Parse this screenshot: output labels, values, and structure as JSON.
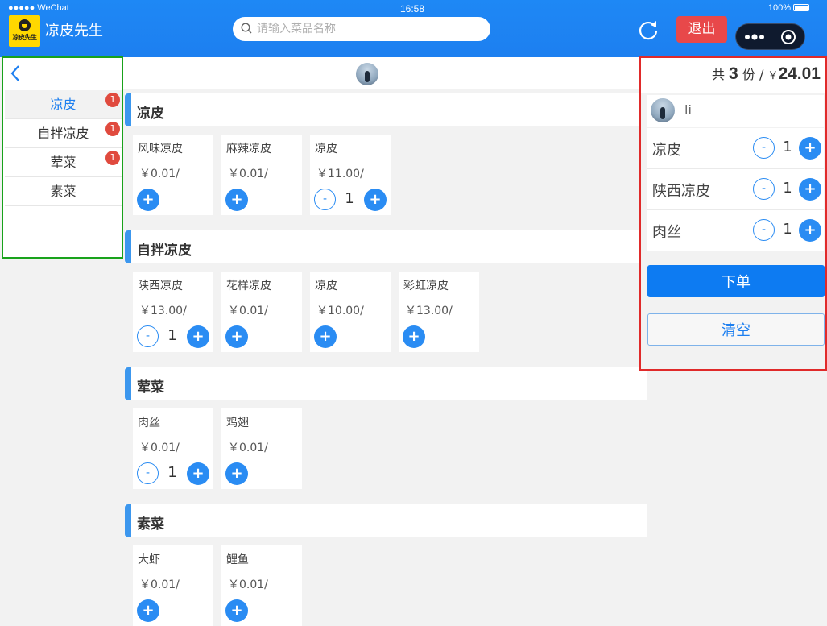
{
  "status_bar": {
    "carrier": "●●●●● WeChat",
    "time": "16:58",
    "battery": "100%"
  },
  "header": {
    "logo_text": "凉皮先生",
    "title": "凉皮先生",
    "search_placeholder": "请输入菜品名称",
    "logout_label": "退出"
  },
  "categories": [
    {
      "label": "凉皮",
      "badge": "1"
    },
    {
      "label": "自拌凉皮",
      "badge": "1"
    },
    {
      "label": "荤菜",
      "badge": "1"
    },
    {
      "label": "素菜",
      "badge": ""
    }
  ],
  "sections": [
    {
      "title": "凉皮",
      "items": [
        {
          "name": "风味凉皮",
          "price": "￥0.01/",
          "qty": ""
        },
        {
          "name": "麻辣凉皮",
          "price": "￥0.01/",
          "qty": ""
        },
        {
          "name": "凉皮",
          "price": "￥11.00/",
          "qty": "1"
        }
      ]
    },
    {
      "title": "自拌凉皮",
      "items": [
        {
          "name": "陕西凉皮",
          "price": "￥13.00/",
          "qty": "1"
        },
        {
          "name": "花样凉皮",
          "price": "￥0.01/",
          "qty": ""
        },
        {
          "name": "凉皮",
          "price": "￥10.00/",
          "qty": ""
        },
        {
          "name": "彩虹凉皮",
          "price": "￥13.00/",
          "qty": ""
        }
      ]
    },
    {
      "title": "荤菜",
      "items": [
        {
          "name": "肉丝",
          "price": "￥0.01/",
          "qty": "1"
        },
        {
          "name": "鸡翅",
          "price": "￥0.01/",
          "qty": ""
        }
      ]
    },
    {
      "title": "素菜",
      "items": [
        {
          "name": "大虾",
          "price": "￥0.01/",
          "qty": ""
        },
        {
          "name": "鲤鱼",
          "price": "￥0.01/",
          "qty": ""
        }
      ]
    }
  ],
  "symbols": {
    "plus": "+",
    "minus": "-"
  },
  "cart": {
    "prefix": "共",
    "count": "3",
    "unit": "份",
    "slash": "/",
    "currency": "￥",
    "total": "24.01",
    "user_name": "li",
    "items": [
      {
        "name": "凉皮",
        "qty": "1"
      },
      {
        "name": "陕西凉皮",
        "qty": "1"
      },
      {
        "name": "肉丝",
        "qty": "1"
      }
    ],
    "order_label": "下单",
    "clear_label": "清空"
  },
  "colors": {
    "accent": "#1d7ff0",
    "logout": "#e8484a",
    "badge": "#e04a3e"
  }
}
